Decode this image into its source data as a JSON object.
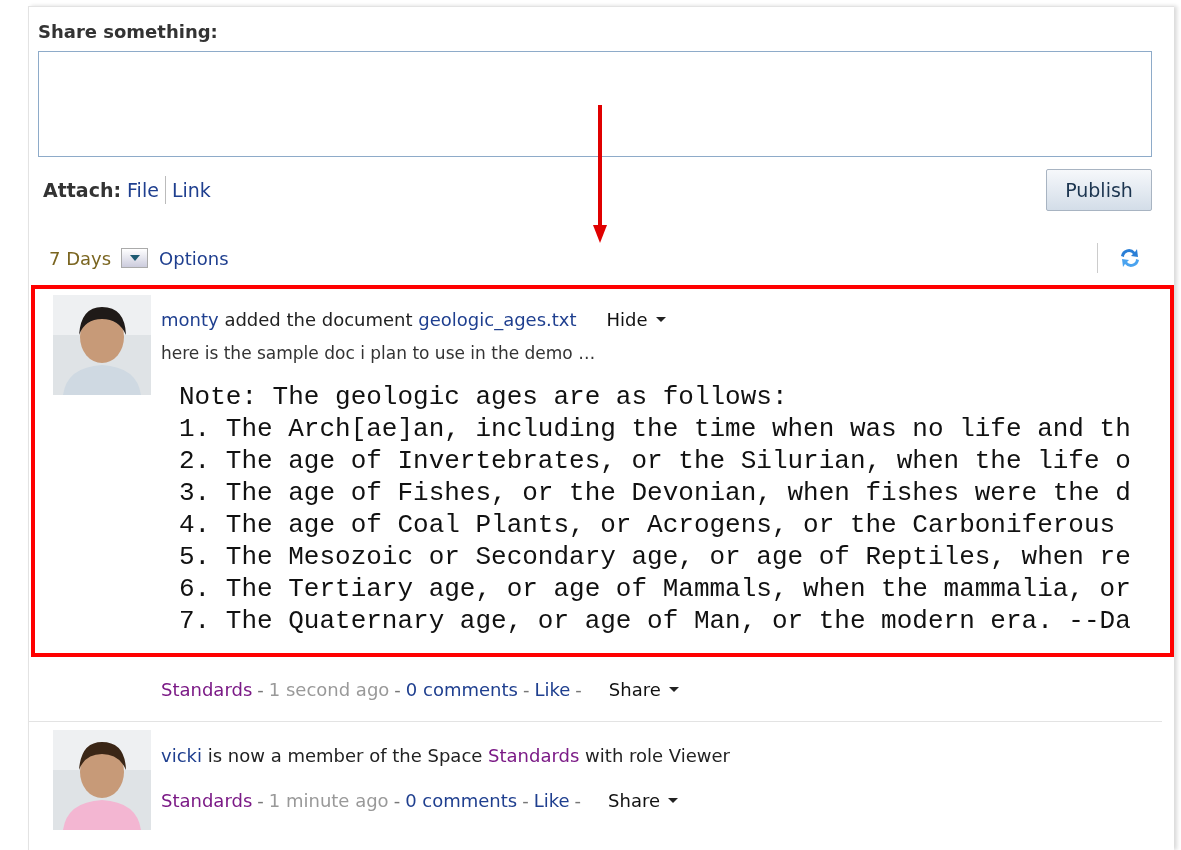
{
  "composer": {
    "label": "Share something:",
    "attach_label": "Attach:",
    "attach_links": [
      "File",
      "Link"
    ],
    "publish": "Publish"
  },
  "filter": {
    "period": "7 Days",
    "options": "Options"
  },
  "feed": [
    {
      "kind": "document",
      "actor": "monty",
      "action": "added the document",
      "target": "geologic_ages.txt",
      "menu": "Hide",
      "description": "here is the sample doc i plan to use in the demo …",
      "preview": [
        "Note: The geologic ages are as follows:",
        "1. The Arch[ae]an, including the time when was no life and th",
        "2. The age of Invertebrates, or the Silurian, when the life o",
        "3. The age of Fishes, or the Devonian, when fishes were the d",
        "4. The age of Coal Plants, or Acrogens, or the Carboniferous",
        "5. The Mesozoic or Secondary age, or age of Reptiles, when re",
        "6. The Tertiary age, or age of Mammals, when the mammalia, or",
        "7. The Quaternary age, or age of Man, or the modern era. --Da"
      ],
      "space": "Standards",
      "separator": "-",
      "time": "1 second ago",
      "comments": "0 comments",
      "like": "Like",
      "share": "Share",
      "highlighted": true
    },
    {
      "kind": "membership",
      "actor": "vicki",
      "text_before": "is now a member of the Space",
      "space_link": "Standards",
      "text_after": "with role Viewer",
      "space": "Standards",
      "separator": "-",
      "time": "1 minute ago",
      "comments": "0 comments",
      "like": "Like",
      "share": "Share",
      "highlighted": false
    }
  ]
}
